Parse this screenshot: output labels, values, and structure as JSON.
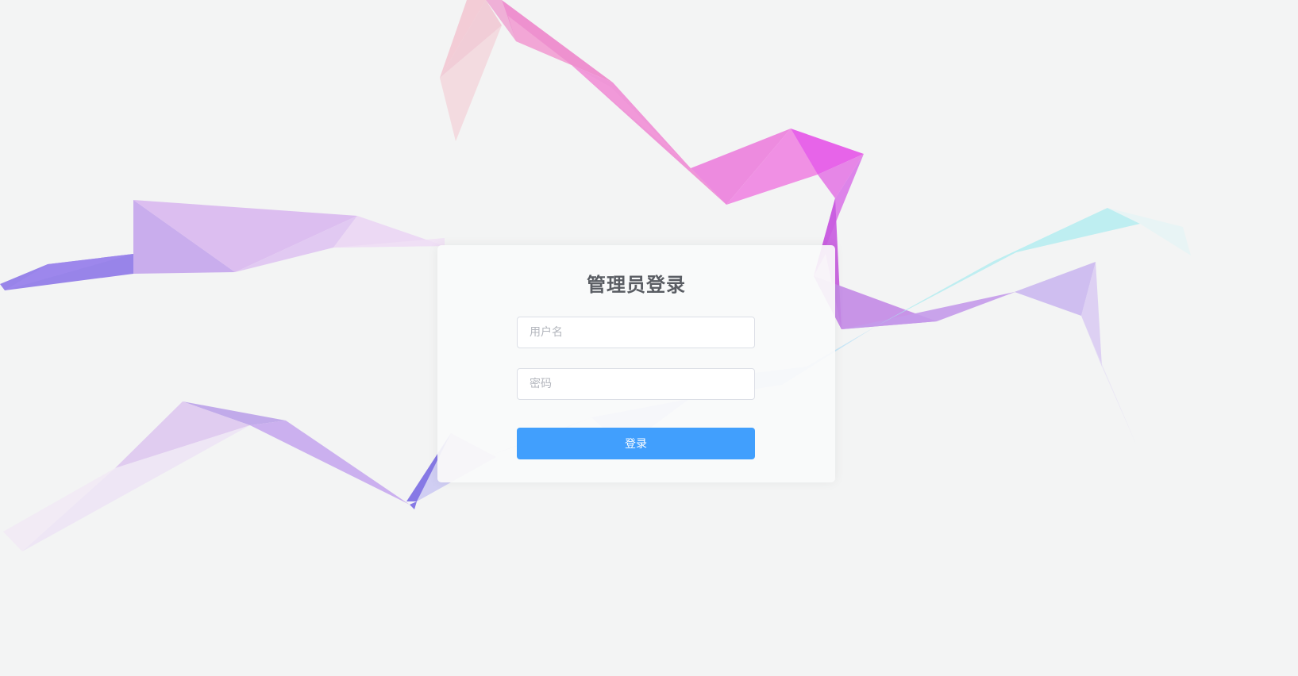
{
  "login": {
    "title": "管理员登录",
    "username_placeholder": "用户名",
    "password_placeholder": "密码",
    "submit_label": "登录"
  },
  "colors": {
    "background": "#f3f4f4",
    "primary_button": "#419ffd",
    "title_text": "#5a5d63"
  }
}
